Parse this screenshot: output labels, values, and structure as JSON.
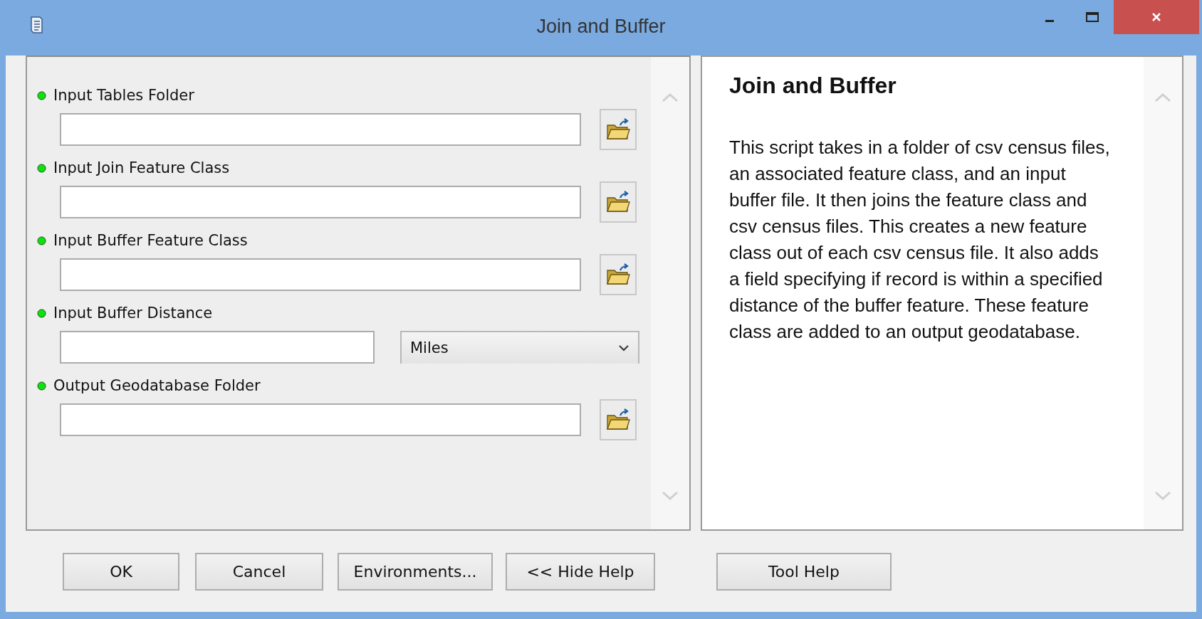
{
  "window": {
    "title": "Join and Buffer"
  },
  "parameters": [
    {
      "kind": "folder",
      "label": "Input Tables Folder"
    },
    {
      "kind": "folder",
      "label": "Input Join Feature Class"
    },
    {
      "kind": "folder",
      "label": "Input Buffer Feature Class"
    },
    {
      "kind": "unit",
      "label": "Input Buffer Distance",
      "unit": "Miles"
    },
    {
      "kind": "folder",
      "label": "Output Geodatabase Folder"
    }
  ],
  "help": {
    "title": "Join and Buffer",
    "text": "This script takes in a folder of csv census files, an associated feature class, and an input buffer file. It then joins the feature class and csv census files. This creates a new feature class out of each csv census file. It also adds a field specifying if record is within a specified distance of the buffer feature. These feature class are added to an output geodatabase."
  },
  "buttons": [
    "OK",
    "Cancel",
    "Environments...",
    "<< Hide Help",
    "Tool Help"
  ]
}
